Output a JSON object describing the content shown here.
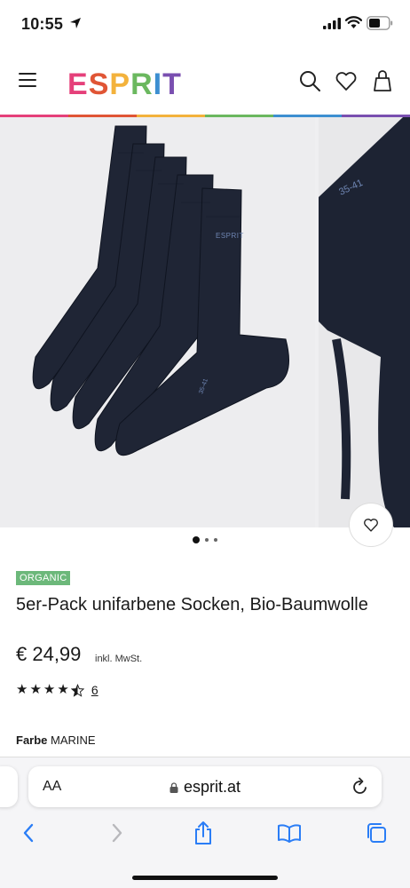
{
  "status_bar": {
    "time": "10:55"
  },
  "header": {
    "logo_letters": [
      "E",
      "S",
      "P",
      "R",
      "I",
      "T"
    ],
    "logo_colors": [
      "#e5407a",
      "#e05535",
      "#f3b23c",
      "#6bb85f",
      "#3d8fd1",
      "#7a4fb0"
    ]
  },
  "rainbow_colors": [
    "#e5407a",
    "#e05535",
    "#f3b23c",
    "#6bb85f",
    "#3d8fd1",
    "#7a4fb0"
  ],
  "gallery": {
    "image_count": 3,
    "active_index": 0,
    "sock_brand": "ESPRIT",
    "sock_size": "35-41"
  },
  "product": {
    "badge": "ORGANIC",
    "title": "5er-Pack unifarbene Socken, Bio-Baumwolle",
    "price": "€ 24,99",
    "tax_note": "inkl. MwSt.",
    "rating": 4.5,
    "review_count": "6",
    "color_label": "Farbe",
    "color_value": "MARINE"
  },
  "browser": {
    "aa_label": "AA",
    "url": "esprit.at"
  },
  "icons": {
    "menu": "hamburger-icon",
    "search": "search-icon",
    "wishlist": "heart-icon",
    "bag": "shopping-bag-icon",
    "back": "chevron-left-icon",
    "forward": "chevron-right-icon",
    "share": "share-icon",
    "bookmarks": "book-icon",
    "tabs": "tabs-icon",
    "reload": "reload-icon",
    "lock": "lock-icon"
  }
}
